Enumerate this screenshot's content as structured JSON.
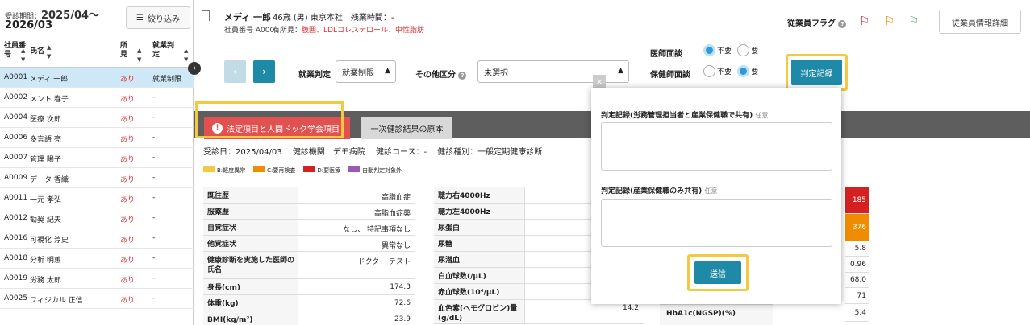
{
  "sidebar": {
    "period_label": "受診期間：",
    "period_from": "2025/04〜",
    "period_to": "2026/03",
    "filter_label": "絞り込み",
    "columns": {
      "id": [
        "社員番",
        "号"
      ],
      "name": "氏名",
      "flag": [
        "所",
        "見"
      ],
      "judge": [
        "就業判",
        "定"
      ]
    },
    "rows": [
      {
        "id": "A0001",
        "name": "メディ 一郎",
        "flag": "あり",
        "judge": "就業制限"
      },
      {
        "id": "A0002",
        "name": "メント 春子",
        "flag": "あり",
        "judge": "-"
      },
      {
        "id": "A0004",
        "name": "医療 次郎",
        "flag": "あり",
        "judge": "-"
      },
      {
        "id": "A0006",
        "name": "多言語 亮",
        "flag": "あり",
        "judge": "-"
      },
      {
        "id": "A0007",
        "name": "管理 陽子",
        "flag": "あり",
        "judge": "-"
      },
      {
        "id": "A0009",
        "name": "データ 香織",
        "flag": "あり",
        "judge": "-"
      },
      {
        "id": "A0011",
        "name": "一元 孝弘",
        "flag": "あり",
        "judge": "-"
      },
      {
        "id": "A0012",
        "name": "勧奨 紀夫",
        "flag": "あり",
        "judge": "-"
      },
      {
        "id": "A0016",
        "name": "可視化 淳史",
        "flag": "あり",
        "judge": "-"
      },
      {
        "id": "A0018",
        "name": "分析 明蕙",
        "flag": "あり",
        "judge": "-"
      },
      {
        "id": "A0019",
        "name": "労務 太郎",
        "flag": "あり",
        "judge": "-"
      },
      {
        "id": "A0025",
        "name": "フィジカル 正信",
        "flag": "あり",
        "judge": "-"
      }
    ]
  },
  "header": {
    "name": "メディ 一郎",
    "info": "46歳 (男) 東京本社　残業時間：-",
    "emp_no": "社員番号 A0001",
    "findings_label": "有所見：",
    "findings": "腹囲、LDLコレステロール、中性脂肪",
    "flag_label": "従業員フラグ",
    "detail_btn": "従業員情報詳細"
  },
  "controls": {
    "prev": "‹",
    "next": "›",
    "judge_label": "就業判定",
    "judge_value": "就業制限",
    "other_label": "その他区分",
    "other_value": "未選択",
    "doctor_label": "医師面談",
    "nurse_label": "保健師面談",
    "opt_no": "不要",
    "opt_yes": "要",
    "record_btn": "判定記録"
  },
  "tabs": {
    "tab1": "法定項目と人間ドック学会項目",
    "tab2": "一次健診結果の原本"
  },
  "exam": {
    "info": "受診日：2025/04/03　 健診機関：デモ病院　 健診コース：-　 健診種別：一般定期健康診断",
    "legend": [
      {
        "label": "B:軽度異常",
        "color": "#f5c842"
      },
      {
        "label": "C:要再検査",
        "color": "#f08c00"
      },
      {
        "label": "D:要医療",
        "color": "#d42020"
      },
      {
        "label": "自動判定対象外",
        "color": "#9b59b6"
      }
    ]
  },
  "table1": [
    {
      "k": "既往歴",
      "v": "高脂血症"
    },
    {
      "k": "服薬歴",
      "v": "高脂血症薬"
    },
    {
      "k": "自覚症状",
      "v": "なし、 特記事項なし"
    },
    {
      "k": "他覚症状",
      "v": "異常なし"
    },
    {
      "k": "健康診断を実施した医師の氏名",
      "v": "ドクター テスト"
    },
    {
      "k": "身長(cm)",
      "v": "174.3"
    },
    {
      "k": "体重(kg)",
      "v": "72.6"
    },
    {
      "k": "BMI(kg/m²)",
      "v": "23.9"
    }
  ],
  "table2": [
    {
      "k": "聴力右4000Hz",
      "v": ""
    },
    {
      "k": "聴力左4000Hz",
      "v": ""
    },
    {
      "k": "尿蛋白",
      "v": ""
    },
    {
      "k": "尿糖",
      "v": ""
    },
    {
      "k": "尿潜血",
      "v": ""
    },
    {
      "k": "白血球数(/μL)",
      "v": ""
    },
    {
      "k": "赤血球数(10⁴/μL)",
      "v": ""
    },
    {
      "k": "血色素(ヘモグロビン)量(g/dL)",
      "v": "14.2"
    }
  ],
  "right_values": [
    {
      "v": "185",
      "color": "#d42020"
    },
    {
      "v": "376",
      "color": "#f08c00"
    },
    {
      "v": "5.8",
      "color": ""
    },
    {
      "v": "0.96",
      "color": ""
    },
    {
      "v": "68.0",
      "color": ""
    },
    {
      "v": "71",
      "color": ""
    },
    {
      "v": "5.4",
      "color": ""
    }
  ],
  "hba1c_label": "HbA1c(NGSP)(%)",
  "popup": {
    "label1": "判定記録(労務管理担当者と産業保健職で共有)",
    "label2": "判定記録(産業保健職のみ共有)",
    "optional": "任意",
    "send": "送信"
  }
}
